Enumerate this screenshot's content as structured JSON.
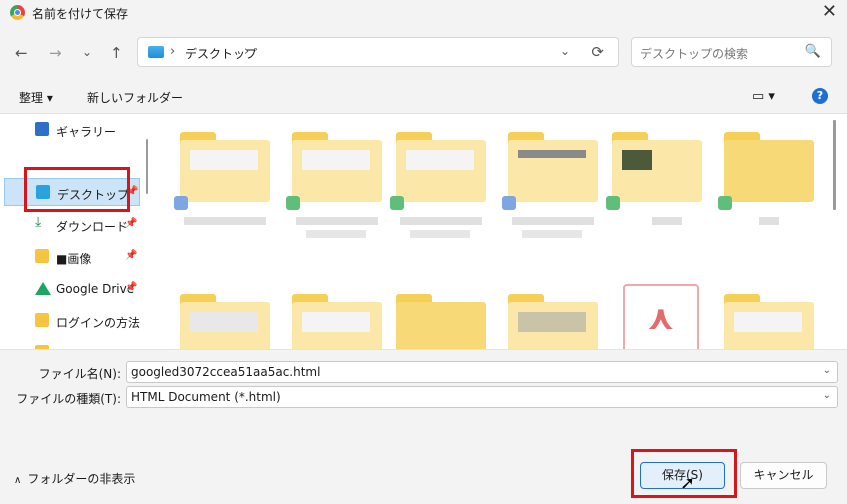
{
  "window": {
    "title": "名前を付けて保存",
    "close_label": "✕"
  },
  "nav": {
    "back": "←",
    "forward": "→",
    "recent": "⌄",
    "up": "↑",
    "address_crumb": "デスクトップ",
    "address_sep": "›",
    "refresh": "⟳",
    "address_dropdown": "⌄"
  },
  "search": {
    "placeholder": "デスクトップの検索",
    "icon": "🔍"
  },
  "toolbar": {
    "organize_label": "整理 ▾",
    "new_folder_label": "新しいフォルダー",
    "view_label": "▭ ▾",
    "help_label": "?"
  },
  "sidebar": {
    "items": [
      {
        "label": "ギャラリー",
        "icon": "gallery-icon",
        "pin": ""
      },
      {
        "label": "デスクトップ",
        "icon": "desktop-icon",
        "pin": "📌"
      },
      {
        "label": "ダウンロード",
        "icon": "download-icon",
        "pin": "📌"
      },
      {
        "label": "■画像",
        "icon": "pictures-icon",
        "pin": "📌"
      },
      {
        "label": "Google Drive",
        "icon": "google-drive-icon",
        "pin": "📌"
      },
      {
        "label": "ログインの方法",
        "icon": "folder-icon",
        "pin": ""
      }
    ]
  },
  "form": {
    "filename_label": "ファイル名(N):",
    "filename_value": "googled3072ccea51aa5ac.html",
    "filetype_label": "ファイルの種類(T):",
    "filetype_value": "HTML Document (*.html)",
    "dropdown_chevron": "⌄"
  },
  "footer": {
    "hide_folders_label": "フォルダーの非表示",
    "hide_folders_icon": "∧",
    "save_label": "保存(S)",
    "cancel_label": "キャンセル"
  },
  "colors": {
    "highlight_box": "#d6161d",
    "accent": "#1f6fd0"
  }
}
